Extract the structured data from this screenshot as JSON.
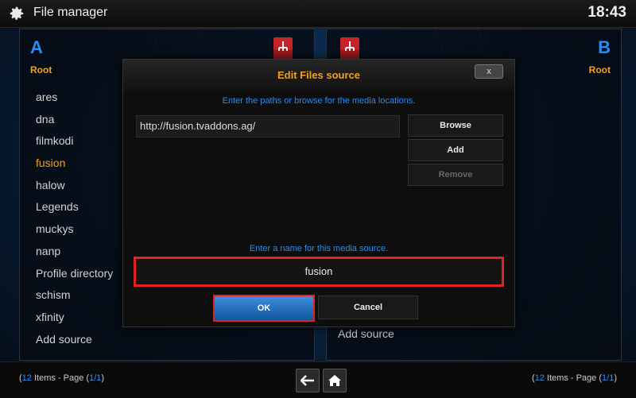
{
  "topbar": {
    "title": "File manager",
    "clock": "18:43"
  },
  "left_panel": {
    "letter": "A",
    "path": "Root",
    "items": [
      "ares",
      "dna",
      "filmkodi",
      "fusion",
      "halow",
      "Legends",
      "muckys",
      "nanp",
      "Profile directory",
      "schism",
      "xfinity",
      "Add source"
    ],
    "selected_index": 3
  },
  "right_panel": {
    "letter": "B",
    "path": "Root",
    "add_source": "Add source"
  },
  "dialog": {
    "title": "Edit Files source",
    "close_label": "x",
    "paths_hint": "Enter the paths or browse for the media locations.",
    "path_value": "http://fusion.tvaddons.ag/",
    "browse_label": "Browse",
    "add_label": "Add",
    "remove_label": "Remove",
    "name_hint": "Enter a name for this media source.",
    "name_value": "fusion",
    "ok_label": "OK",
    "cancel_label": "Cancel"
  },
  "bottombar": {
    "left": {
      "count": "12",
      "items_text": " Items - Page ",
      "page": "1/1"
    },
    "right": {
      "count": "12",
      "items_text": " Items - Page ",
      "page": "1/1"
    },
    "back_icon": "arrow-left-icon",
    "home_icon": "home-icon"
  },
  "colors": {
    "accent_blue": "#2a8cf0",
    "accent_orange": "#f0a020",
    "highlight_red": "#e02222"
  }
}
